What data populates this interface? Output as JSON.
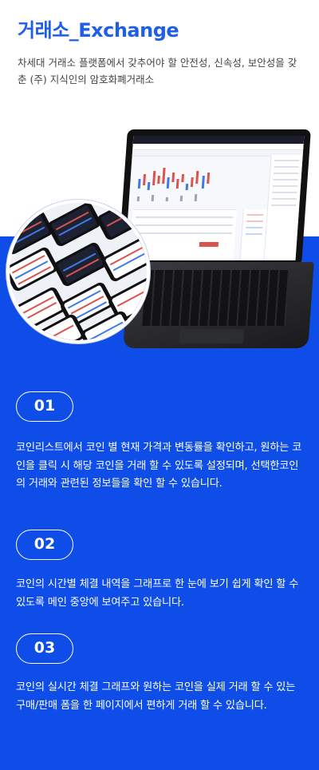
{
  "header": {
    "title": "거래소_Exchange",
    "description": "차세대 거래소 플랫폼에서 갖추어야 할 안전성, 신속성, 보안성을 갖춘 (주) 지식인의 암호화폐거래소"
  },
  "colors": {
    "accent_blue": "#1f5ee6",
    "section_blue": "#0e4de8"
  },
  "features": [
    {
      "number": "01",
      "text": "코인리스트에서 코인 별 현재 가격과 변동률을 확인하고, 원하는 코인을 클릭 시 해당 코인을 거래 할 수 있도록 설정되며, 선택한코인의 거래와 관련된 정보들을 확인 할 수 있습니다."
    },
    {
      "number": "02",
      "text": "코인의 시간별 체결 내역을 그래프로 한 눈에 보기 쉽게 확인 할 수 있도록 메인 중앙에 보여주고 있습니다."
    },
    {
      "number": "03",
      "text": "코인의 실시간 체결 그래프와 원하는 코인을 실제 거래 할 수 있는 구매/판매 폼을 한 페이지에서 편하게 거래 할 수 있습니다."
    }
  ]
}
